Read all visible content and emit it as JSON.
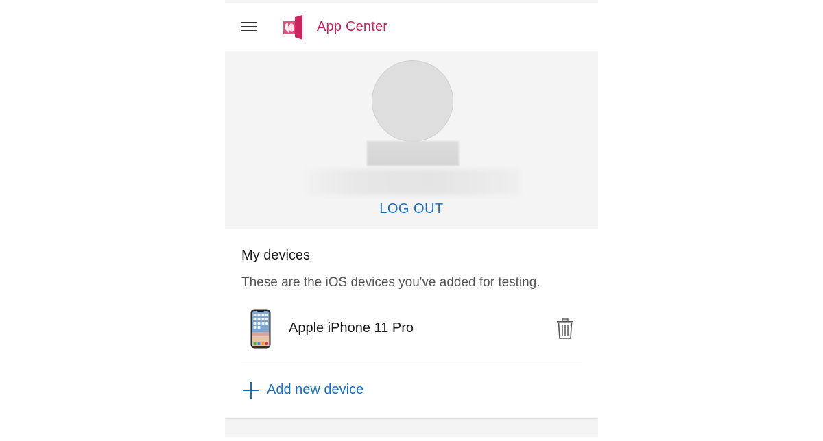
{
  "header": {
    "app_title": "App Center",
    "menu_icon": "hamburger-menu-icon",
    "logo_icon": "app-center-logo",
    "brand_color": "#c8245f"
  },
  "profile": {
    "avatar_icon": "user-avatar",
    "name_redacted": "",
    "email_redacted": "",
    "logout_label": "LOG OUT",
    "link_color": "#1a6fbd"
  },
  "devices": {
    "title": "My devices",
    "description": "These are the iOS devices you've added for testing.",
    "items": [
      {
        "name": "Apple iPhone 11 Pro",
        "image_icon": "iphone-device-image",
        "delete_icon": "trash-icon"
      }
    ],
    "add_label": "Add new device",
    "add_icon": "plus-icon"
  }
}
